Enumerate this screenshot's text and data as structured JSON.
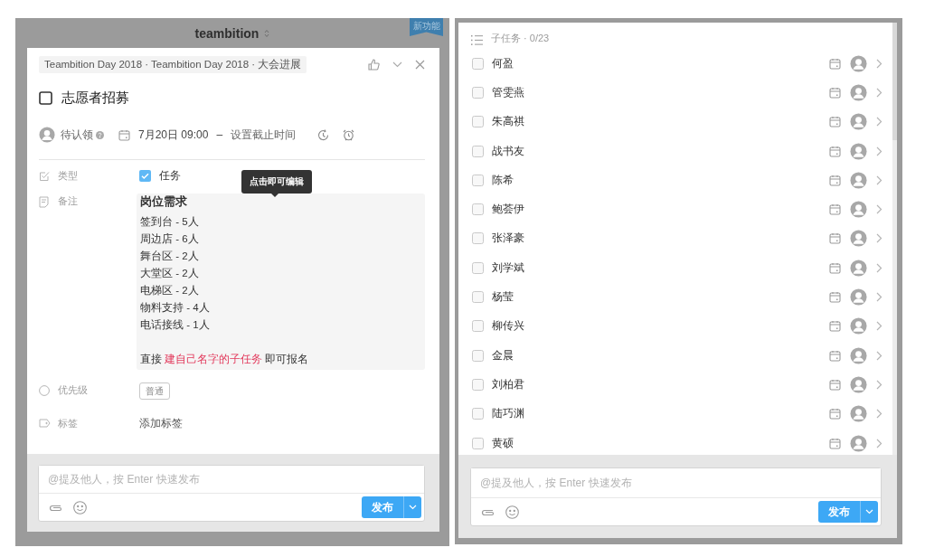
{
  "left_panel": {
    "app_header": {
      "logo": "teambition",
      "ribbon": "新功能"
    },
    "task": {
      "breadcrumb": "Teambition Day 2018 · Teambition Day 2018 · 大会进展",
      "title": "志愿者招募",
      "completed": false,
      "assignee": "待认领",
      "start_date": "7月20日 09:00",
      "separator": "–",
      "due_date": "设置截止时间",
      "fields": [
        {
          "kind": "type",
          "label": "类型",
          "value": "任务",
          "checked": true
        },
        {
          "kind": "note",
          "label": "备注",
          "heading": "岗位需求",
          "lines": [
            "签到台 - 5人",
            "周边店 - 6人",
            "舞台区 - 2人",
            "大堂区 - 2人",
            "电梯区 - 2人",
            "物料支持 - 4人",
            "电话接线 - 1人"
          ],
          "footer_before": "直接",
          "footer_link": "建自己名字的子任务",
          "footer_after": "即可报名"
        },
        {
          "kind": "priority",
          "label": "优先级",
          "value": "普通"
        },
        {
          "kind": "tags",
          "label": "标签",
          "value": "添加标签"
        }
      ],
      "tooltip": "点击即可编辑"
    },
    "comment": {
      "placeholder": "@提及他人，按 Enter 快速发布",
      "send": "发布"
    }
  },
  "right_panel": {
    "subtask_header": "子任务 · 0/23",
    "subtasks": [
      {
        "name": "何盈",
        "checked": false
      },
      {
        "name": "管雯燕",
        "checked": false
      },
      {
        "name": "朱高祺",
        "checked": false
      },
      {
        "name": "战书友",
        "checked": false
      },
      {
        "name": "陈希",
        "checked": false
      },
      {
        "name": "鲍荟伊",
        "checked": false
      },
      {
        "name": "张泽豪",
        "checked": false
      },
      {
        "name": "刘学斌",
        "checked": false
      },
      {
        "name": "杨莹",
        "checked": false
      },
      {
        "name": "柳传兴",
        "checked": false
      },
      {
        "name": "金晨",
        "checked": false
      },
      {
        "name": "刘柏君",
        "checked": false
      },
      {
        "name": "陆巧渊",
        "checked": false
      },
      {
        "name": "黄硕",
        "checked": false
      }
    ],
    "comment": {
      "placeholder": "@提及他人，按 Enter 快速发布",
      "send": "发布"
    }
  }
}
